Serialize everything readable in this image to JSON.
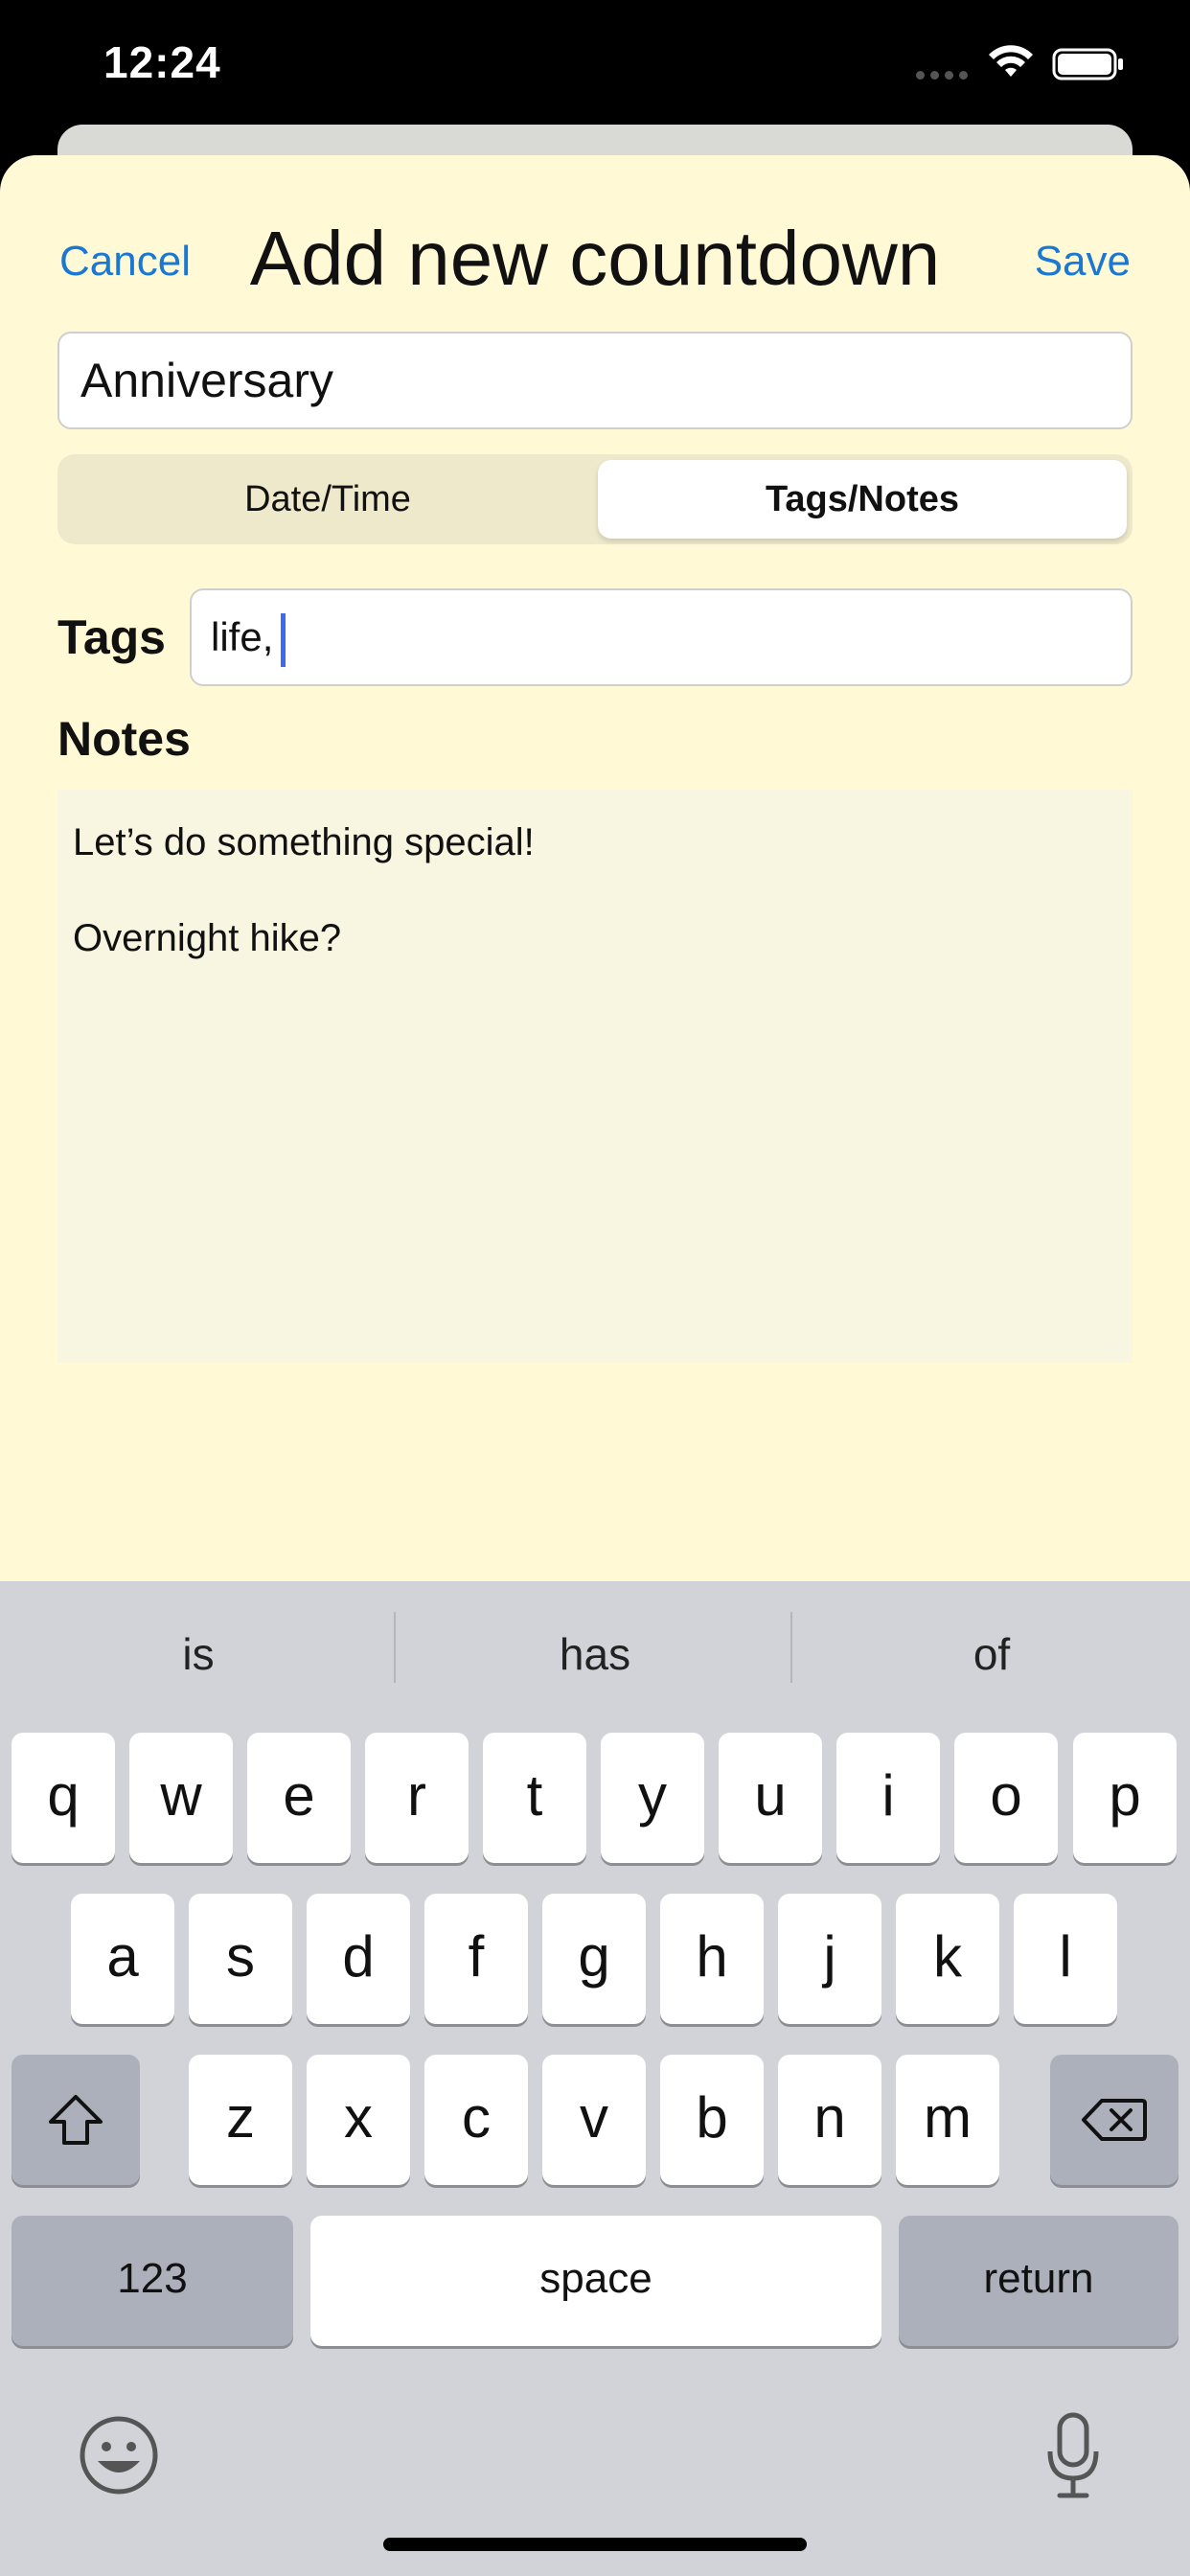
{
  "status_bar": {
    "time": "12:24"
  },
  "nav": {
    "cancel": "Cancel",
    "title": "Add new countdown",
    "save": "Save"
  },
  "form": {
    "name_value": "Anniversary",
    "segments": [
      "Date/Time",
      "Tags/Notes"
    ],
    "selected_segment": "Tags/Notes",
    "tags_label": "Tags",
    "tags_value": "life,",
    "notes_label": "Notes",
    "notes_lines": [
      "Let’s do something special!",
      "Overnight hike?"
    ]
  },
  "keyboard": {
    "suggestions": [
      "is",
      "has",
      "of"
    ],
    "row1": [
      "q",
      "w",
      "e",
      "r",
      "t",
      "y",
      "u",
      "i",
      "o",
      "p"
    ],
    "row2": [
      "a",
      "s",
      "d",
      "f",
      "g",
      "h",
      "j",
      "k",
      "l"
    ],
    "row3": [
      "z",
      "x",
      "c",
      "v",
      "b",
      "n",
      "m"
    ],
    "numbers_key": "123",
    "space_key": "space",
    "return_key": "return"
  },
  "colors": {
    "sheet_bg": "#fff9d6",
    "accent": "#1a78d2",
    "caret": "#3a6cf0"
  }
}
